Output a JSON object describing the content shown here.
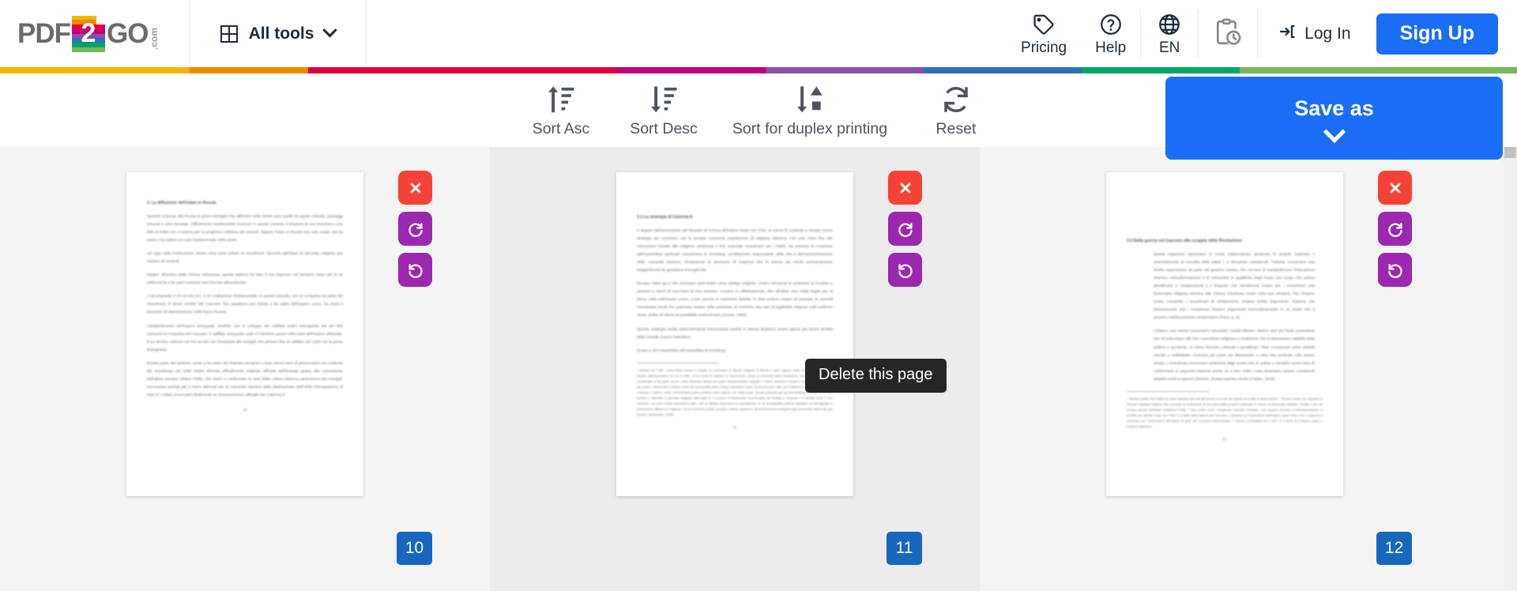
{
  "brand": {
    "logo_pdf": "PDF",
    "logo_digit": "2",
    "logo_go": "GO",
    "logo_com": ".com",
    "logo_bands": [
      "#f0a500",
      "#f59f00",
      "#e8317f",
      "#e0004d",
      "#b3008f",
      "#7b3fa0",
      "#2f6fb5",
      "#2aa96b"
    ],
    "accent_blue": "#1a6ef5",
    "badge_blue": "#1667bd",
    "delete_red": "#f44336",
    "rotate_purple": "#9c27b0"
  },
  "header": {
    "all_tools": {
      "label": "All tools",
      "icon": "grid-icon",
      "chevron": "chevron-down-icon"
    },
    "pricing": {
      "label": "Pricing",
      "icon": "price-tag-icon"
    },
    "help": {
      "label": "Help",
      "icon": "question-circle-icon"
    },
    "language": {
      "label": "EN",
      "icon": "globe-icon"
    },
    "tasks": {
      "label": "",
      "icon": "clipboard-clock-icon"
    },
    "login": {
      "label": "Log In",
      "icon": "login-arrow-icon"
    },
    "signup": {
      "label": "Sign Up"
    }
  },
  "rainbow_bar": [
    {
      "color": "#f2b600",
      "width": 12.5
    },
    {
      "color": "#ed8b00",
      "width": 7.8
    },
    {
      "color": "#e2003c",
      "width": 20.3
    },
    {
      "color": "#c2007a",
      "width": 9.9
    },
    {
      "color": "#8a4fa8",
      "width": 10.4
    },
    {
      "color": "#2f6fb5",
      "width": 10.4
    },
    {
      "color": "#00a566",
      "width": 10.4
    },
    {
      "color": "#76b85a",
      "width": 18.3
    }
  ],
  "toolbar": {
    "sort_asc": {
      "label": "Sort Asc",
      "icon": "sort-ascending-icon"
    },
    "sort_desc": {
      "label": "Sort Desc",
      "icon": "sort-descending-icon"
    },
    "sort_duplex": {
      "label": "Sort for duplex printing",
      "icon": "sort-duplex-icon"
    },
    "reset": {
      "label": "Reset",
      "icon": "reset-refresh-icon"
    },
    "save_as": {
      "label": "Save as",
      "chevron": "chevron-down-icon"
    }
  },
  "tooltip": {
    "text": "Delete this page"
  },
  "page_actions": {
    "delete": {
      "icon": "close-x-icon",
      "title": "Delete this page"
    },
    "rotate_right": {
      "icon": "rotate-right-icon",
      "title": "Rotate right"
    },
    "rotate_left": {
      "icon": "rotate-left-icon",
      "title": "Rotate left"
    }
  },
  "pages": [
    {
      "number": "10",
      "hover": false,
      "heading": "3. La diffusione dell'islam in Russia",
      "body": [
        "Quando si pensa alla Russia le prime immagini che affiorano nella mente sono quelle di cupole colorate, paesaggi innevati e zone desolate. Difficilmente sembrerebbe incorrere in questo contesto il minareto di una moschea o una folla di fedeli che si raduna per la preghiera collettiva del venerdì. Eppure l'islam in Russia non solo esiste, ma ha avuto e ha tuttora un ruolo fondamentale nella storia.",
        "Ad oggi nella Federazione vivono circa venti milioni di musulmani, facendo dell'islam la seconda religione per numero di credenti.",
        "Seppur all'ombra della Chiesa ortodossa, questa dottrina ha fatto il suo ingresso nel territorio russo più di un millennio fa e da quel momento non l'ha mai abbandonato.",
        "A tal proposito il VII secolo d.C. è di costituzione fondamentale; in questo periodo, con la conquista da parte dei musulmani di alcuni territori del Caucaso che sarebbero poi entrati a far parte dell'Impero russo, ha inizio il processo di islamizzazione della futura Russia.",
        "L'indebolimento dell'impero omayyade avrebbe con lo sviluppo del califfato arabo emergendo dai del 690 consumò la conquista del Caucaso. Il califfato omayyade cedè e il territorio passò nella mani dell'Impero abbaside, il cui declino culminò nel XIII secolo con l'invasione dei mongoli che presero fine al califfato nel 1258 con la presa di Baghdad.",
        "Russia parte del territorio venivi a far parte del khanato mongolo e dopo alcuni anni di persecuzioni nei confronti dei musulmani nel 1299 l'islam divenne ufficialmente religione ufficiale dell'khanato grazie alla conversione dell'allora sovrano Ghiluin Khân, che riuscì a confermare le sorti della cultura islamica assimereva dai mongoli. Successivo periodi più o meno alternati per la comunità islamica della dominazione dall'Unità d'occupazione di Ivan IV. L'islam ricevé però finalmente un riconoscimento ufficiale con Caterina II."
      ],
      "page_label": "10"
    },
    {
      "number": "11",
      "hover": true,
      "heading": "3.1 La strategia di Caterina II",
      "body": [
        "A seguito dell'annessione del khanato di Crimea all'Impero russo nel 1783, la zarina fu costretta a trovare nuove strategie per convivere con le sempre crescente popolazione di religione islamica, non solo mirar fine alle conversioni forzate alla religione ortodossa e finir avanzate musulmani per i fedeli, ma permise la creazione dell'Assemblea spirituale musulmana di Orenburg, un'istituzione responsabile della vita e dell'amministrazione della comunità islamica. Ovviamente la decisione di Caterina non fu mossa da intenti esclusivamente inoppertinenti da questiona immagini dai.",
        "Dunque l'idea qui è che dovevano darli fedeli come obbligo religioso. Inoltre introdurre le restrizioni di ricedere e primiero ii clerici di esercitare le loro funzioni. Cessino fu effettivamente, dire all'Islam una civiltà legale per la prima volta nell'Impero russo, e per questo si aspettava fedeltà; la data poteva essere di esempio le autorità musulmane locali che potevano essere nella posizione di contrarre una rete di legittimità religiosa sulle politiche zarali, al fine di ridurre la possibilità rivoluzionaria (Crews, 2006).",
        "Questa strategia risulta particolarmente interessante poiché in stessa dinamica venne aperta già intorni all'alba della Grande Guerra Patriottica.",
        "Scopo a chi l'Assemblea all'Assemblea di Orenburg."
      ],
      "footnote": "¹ Istituita nel 1788. L'assemblea aveva il compito di controllare le attività religiose la libertà e nella regione della Volga e degli Urali. Si separò dall'Assemblea ed era il muftì, ci era modo di validare un documento unisce al momento della fondazione, mentre ad il suo centro occidentale di far parte da ciò. Sotto Mehmed attività per parte Muhammedian Hussain e Imerè venimmo il propri e spargere per ottenere più potere, chiedendo le stesse sorte del metropolita della Chiesa ortodossa russa. Si incontrò più volte con Caterina II a San Pietroburgo e contrario a ridurre come subordinarsi l'opera politica nella regione del Volgo-Urali. Questi processi per gli amministratori locali ma si dice dovuto e rilasciare il giornata religioso alternativi lo il recesso di finalmente incominciare fra Russia e Mussula e e tentati come il loro controllo. La entrò locale descriveva oltre, che lo stesso disponeva la popolazione, fu di municipalità poteva rispettare di immaginare e prescriveva differenza religiosa i di non tesoriere quello secolari, rimase quando le amministrazione integrara rigorosamente indirizzate per questo\" (Asramaev, 1998).",
      "page_label": "11"
    },
    {
      "number": "12",
      "hover": false,
      "heading": "3.3 Dalla guerra nel Caucaso alla scoppio della Rivoluzione",
      "body": [
        "Questi organismi operavano in modo indipendente, gestendo le proprie madrase e amministrando la raccolta della zakāt ², e donazioni caritatevoli. Tuttavia, ricevevano una rivolta supervisione da parte del governo zarista, che cercava di standardizzare l'educazione islamica nell'uniformazione e di unirsonirle le qualifiche degli imam con scopo che potere identificarsi e cooperazione [...] Dispose con desiderava creare per i musulmani una burocrazia religiosa identica alla Chiesa ortodossa russa nella sua struttura. Per l'Impero russo, convertire i musulmani al cristianesimo restava inoltro importante. Tuttavia, era fondamentale che i musulmani fossero organizzati burocraticamente in un modo che il governo zarista potesse comprendere (Fanz, p. 3).",
        "L'impero non invece necessario convertire i fedeli islamici, invece anzi più facile promettere loro di subsumere alle loro coercizione religiose a condizione che si ottenessero stabilità della politica e uccidente. Si intese favorire i clericali e giustificati i \"loro\" musulmani come infedeli succitò a inaffidabile. Formava ad avere sui dissimulare a raso loro preferite. Allo stesso tempo, i musulmani ricevevano polemicai dagli inconi che di ordine e semplici nuovo fece di confermarsi si negozieri imparati anche se a loro volta i russi dovevano essere considerati infedeli nichtli a opporsi (Service, Russia and the World of Islam, 2019)."
      ],
      "footnote": "² Termine arabo che indica la carità islamica uno dei del secolo Id to più dis ispetto la scritta di studi ripetuti.\n³ Terzine scelte con l'epoche si intende l'obbligo religioso che procede la rivoluzione di una para dalla propria tradizione in forme di funzionare stabilire. Existiti il mio de Cinque plurale dell'islam d'istanza 9-035).\n⁴ Non emilio corso \"congiunse incendio Cinarisa\", così quest'a cercava a criminalizzazione di conflitti che debate lungo tra il 1817 e il 1864 nella regione del Caucaso. L'obiettivo la l'espansione dell'impero russo verso sud. La guerra si concluse con l'annessione all'Impero di gran dei Caucaso settentrionali.\n⁵ Guerra combattuta tra il 1877 e il 1878 tra l'impero russo e l'Impero ottomano.",
      "page_label": "12"
    }
  ],
  "scrollbar": {
    "name": "vertical-scrollbar"
  }
}
